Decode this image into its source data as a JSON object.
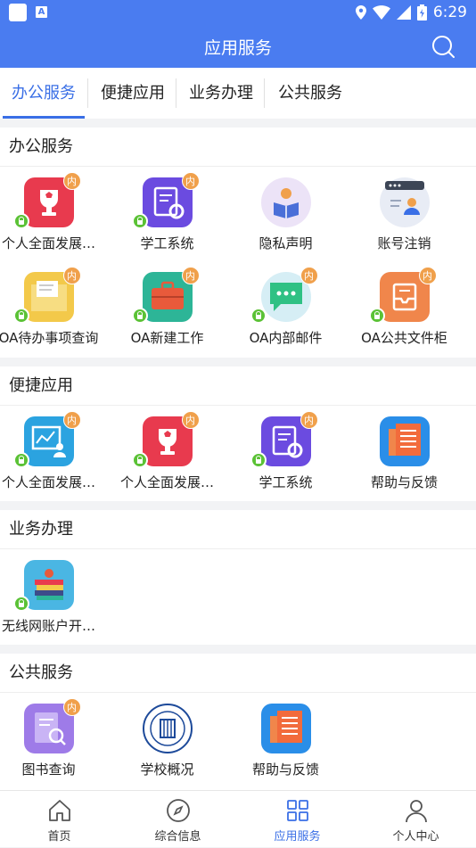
{
  "status": {
    "time": "6:29"
  },
  "appbar": {
    "title": "应用服务"
  },
  "tabs": [
    "办公服务",
    "便捷应用",
    "业务办理",
    "公共服务"
  ],
  "badge_text": "内",
  "sections": {
    "office": {
      "title": "办公服务",
      "items": [
        {
          "label": "个人全面发展…",
          "icon": "trophy-icon"
        },
        {
          "label": "学工系统",
          "icon": "clipboard-gear-icon"
        },
        {
          "label": "隐私声明",
          "icon": "reading-person-icon"
        },
        {
          "label": "账号注销",
          "icon": "account-window-icon"
        },
        {
          "label": "OA待办事项查询",
          "icon": "folder-docs-icon"
        },
        {
          "label": "OA新建工作",
          "icon": "briefcase-icon"
        },
        {
          "label": "OA内部邮件",
          "icon": "chat-bubble-icon"
        },
        {
          "label": "OA公共文件柜",
          "icon": "inbox-tray-icon"
        }
      ]
    },
    "convenient": {
      "title": "便捷应用",
      "items": [
        {
          "label": "个人全面发展…",
          "icon": "chart-person-icon"
        },
        {
          "label": "个人全面发展…",
          "icon": "trophy-icon"
        },
        {
          "label": "学工系统",
          "icon": "clipboard-gear-icon"
        },
        {
          "label": "帮助与反馈",
          "icon": "newspaper-icon"
        }
      ]
    },
    "business": {
      "title": "业务办理",
      "items": [
        {
          "label": "无线网账户开…",
          "icon": "books-icon"
        }
      ]
    },
    "public": {
      "title": "公共服务",
      "items": [
        {
          "label": "图书查询",
          "icon": "document-search-icon"
        },
        {
          "label": "学校概况",
          "icon": "university-seal-icon"
        },
        {
          "label": "帮助与反馈",
          "icon": "newspaper-icon"
        }
      ]
    }
  },
  "bottom_nav": [
    {
      "label": "首页",
      "icon": "home-icon"
    },
    {
      "label": "综合信息",
      "icon": "compass-icon"
    },
    {
      "label": "应用服务",
      "icon": "grid-icon"
    },
    {
      "label": "个人中心",
      "icon": "person-icon"
    }
  ],
  "colors": {
    "primary": "#4a7cf0",
    "active": "#3a6fe6",
    "badge": "#f0a04b",
    "lock": "#5bc236"
  }
}
